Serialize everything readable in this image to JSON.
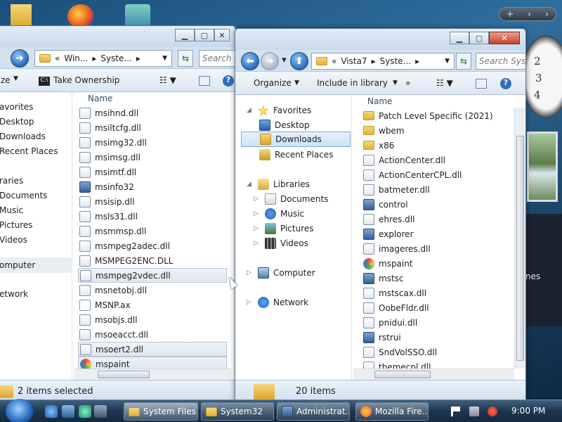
{
  "taskbar": {
    "items": [
      {
        "label": "System Files",
        "active": true
      },
      {
        "label": "System32",
        "active": false
      },
      {
        "label": "Administrat...",
        "active": false
      },
      {
        "label": "Mozilla Fire...",
        "active": false
      }
    ],
    "clock": "9:00 PM"
  },
  "gadgets": {
    "bar_symbols": [
      "+",
      "‹",
      "›"
    ],
    "clock_numbers": [
      "2",
      "3",
      "4"
    ],
    "side_text": "nes"
  },
  "left_window": {
    "address": [
      "«",
      "Win...",
      "Syste...",
      "▸"
    ],
    "search_placeholder": "Search S",
    "toolbar": {
      "organize": "ze",
      "take_ownership": "Take Ownership"
    },
    "nav": [
      "avorites",
      "Desktop",
      "Downloads",
      "Recent Places",
      "raries",
      "Documents",
      "Music",
      "Pictures",
      "Videos",
      "omputer",
      "etwork"
    ],
    "column_header": "Name",
    "files": [
      {
        "name": "msihnd.dll",
        "icon": "dll-icon"
      },
      {
        "name": "msiltcfg.dll",
        "icon": "dll-icon"
      },
      {
        "name": "msimg32.dll",
        "icon": "dll-icon"
      },
      {
        "name": "msimsg.dll",
        "icon": "dll-icon"
      },
      {
        "name": "msimtf.dll",
        "icon": "dll-icon"
      },
      {
        "name": "msinfo32",
        "icon": "app-icon"
      },
      {
        "name": "msisip.dll",
        "icon": "dll-icon"
      },
      {
        "name": "msls31.dll",
        "icon": "dll-icon"
      },
      {
        "name": "msmmsp.dll",
        "icon": "dll-icon"
      },
      {
        "name": "msmpeg2adec.dll",
        "icon": "dll-icon"
      },
      {
        "name": "MSMPEG2ENC.DLL",
        "icon": "dll-icon"
      },
      {
        "name": "msmpeg2vdec.dll",
        "icon": "dll-icon",
        "selected": true
      },
      {
        "name": "msnetobj.dll",
        "icon": "dll-icon"
      },
      {
        "name": "MSNP.ax",
        "icon": "blank-file-icon"
      },
      {
        "name": "msobjs.dll",
        "icon": "dll-icon"
      },
      {
        "name": "msoeacct.dll",
        "icon": "dll-icon"
      },
      {
        "name": "msoert2.dll",
        "icon": "dll-icon",
        "selected": true
      },
      {
        "name": "mspaint",
        "icon": "paint-icon",
        "selected": true
      }
    ],
    "status": "2 items selected"
  },
  "right_window": {
    "address": [
      "«",
      "Vista7",
      "Syste...",
      "▸"
    ],
    "search_placeholder": "Search Syst",
    "toolbar": {
      "organize": "Organize",
      "include": "Include in library"
    },
    "nav": {
      "favorites": "Favorites",
      "desktop": "Desktop",
      "downloads": "Downloads",
      "recent": "Recent Places",
      "libraries": "Libraries",
      "documents": "Documents",
      "music": "Music",
      "pictures": "Pictures",
      "videos": "Videos",
      "computer": "Computer",
      "network": "Network"
    },
    "column_header": "Name",
    "files": [
      {
        "name": "Patch Level Specific (2021)",
        "icon": "folder-icon"
      },
      {
        "name": "wbem",
        "icon": "folder-icon"
      },
      {
        "name": "x86",
        "icon": "folder-icon"
      },
      {
        "name": "ActionCenter.dll",
        "icon": "dll-icon"
      },
      {
        "name": "ActionCenterCPL.dll",
        "icon": "dll-icon"
      },
      {
        "name": "batmeter.dll",
        "icon": "dll-icon"
      },
      {
        "name": "control",
        "icon": "app-icon"
      },
      {
        "name": "ehres.dll",
        "icon": "dll-icon"
      },
      {
        "name": "explorer",
        "icon": "app-icon"
      },
      {
        "name": "imageres.dll",
        "icon": "dll-icon"
      },
      {
        "name": "mspaint",
        "icon": "paint-icon"
      },
      {
        "name": "mstsc",
        "icon": "app-icon"
      },
      {
        "name": "mstscax.dll",
        "icon": "dll-icon"
      },
      {
        "name": "OobeFldr.dll",
        "icon": "dll-icon"
      },
      {
        "name": "pnidui.dll",
        "icon": "dll-icon"
      },
      {
        "name": "rstrui",
        "icon": "app-icon"
      },
      {
        "name": "SndVolSSO.dll",
        "icon": "dll-icon"
      },
      {
        "name": "themecpl.dll",
        "icon": "dll-icon"
      }
    ],
    "status": "20 items"
  }
}
